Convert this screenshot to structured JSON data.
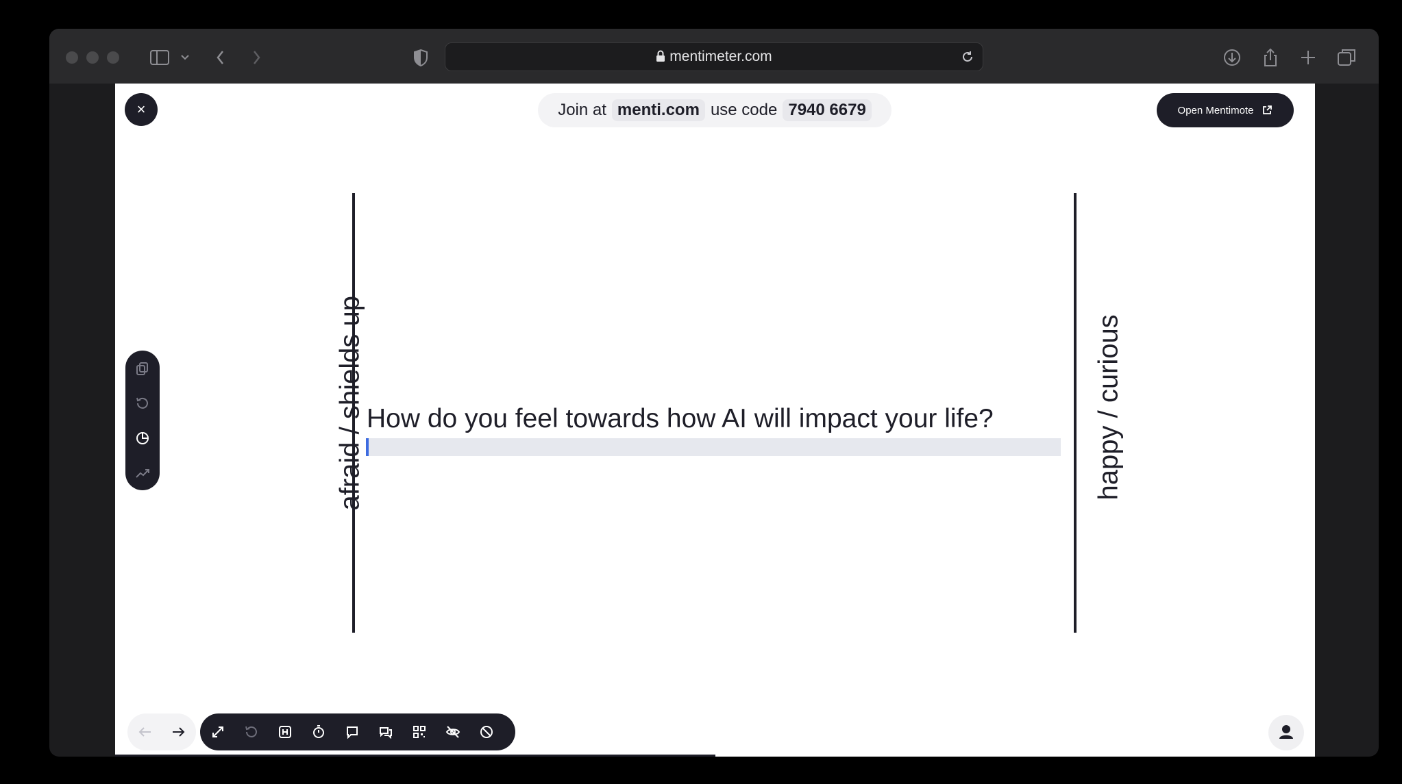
{
  "browser": {
    "url": "mentimeter.com",
    "icons": [
      "sidebar-icon",
      "chevron-down-icon",
      "back-icon",
      "forward-icon",
      "shield-icon",
      "lock-icon",
      "reload-icon",
      "download-icon",
      "share-icon",
      "plus-icon",
      "tabs-icon"
    ]
  },
  "header": {
    "close_icon": "×",
    "join_prefix": "Join at",
    "join_url": "menti.com",
    "code_prefix": "use code",
    "code": "7940 6679",
    "open_button": "Open Mentimote"
  },
  "slide": {
    "question": "How do you feel towards how AI will impact your life?",
    "left_label": "afraid / shields up",
    "right_label": "happy / curious"
  },
  "colors": {
    "dark": "#1e1e28",
    "accent": "#3d6be0"
  }
}
